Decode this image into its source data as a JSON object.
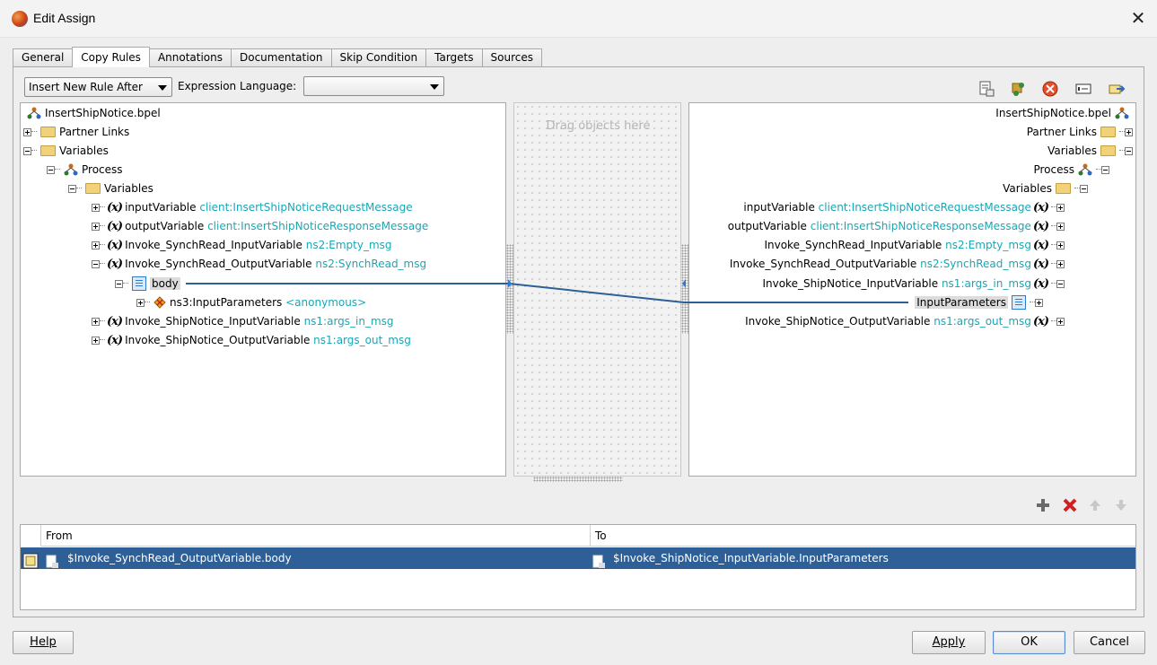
{
  "window": {
    "title": "Edit Assign",
    "close_glyph": "✕"
  },
  "tabs": [
    "General",
    "Copy Rules",
    "Annotations",
    "Documentation",
    "Skip Condition",
    "Targets",
    "Sources"
  ],
  "active_tab": "Copy Rules",
  "toolbar": {
    "insert_rule": "Insert New Rule After",
    "expression_language_label": "Expression Language:",
    "expression_language_value": "",
    "icons": [
      "xpath-function-icon",
      "xml-fragment-icon",
      "bpel-literal-icon",
      "expression-icon",
      "copy-list-icon"
    ]
  },
  "source_tree": {
    "root": "InsertShipNotice.bpel",
    "partner_links": "Partner Links",
    "variables": "Variables",
    "process": "Process",
    "process_variables": "Variables",
    "items": [
      {
        "name": "inputVariable",
        "type": "client:InsertShipNoticeRequestMessage"
      },
      {
        "name": "outputVariable",
        "type": "client:InsertShipNoticeResponseMessage"
      },
      {
        "name": "Invoke_SynchRead_InputVariable",
        "type": "ns2:Empty_msg"
      },
      {
        "name": "Invoke_SynchRead_OutputVariable",
        "type": "ns2:SynchRead_msg"
      },
      {
        "name": "Invoke_ShipNotice_InputVariable",
        "type": "ns1:args_in_msg"
      },
      {
        "name": "Invoke_ShipNotice_OutputVariable",
        "type": "ns1:args_out_msg"
      }
    ],
    "part": "body",
    "element": {
      "name": "ns3:InputParameters",
      "type": "<anonymous>"
    }
  },
  "drag_area": {
    "placeholder": "Drag objects here"
  },
  "target_tree": {
    "root": "InsertShipNotice.bpel",
    "partner_links": "Partner Links",
    "variables": "Variables",
    "process": "Process",
    "process_variables": "Variables",
    "items": [
      {
        "name": "inputVariable",
        "type": "client:InsertShipNoticeRequestMessage"
      },
      {
        "name": "outputVariable",
        "type": "client:InsertShipNoticeResponseMessage"
      },
      {
        "name": "Invoke_SynchRead_InputVariable",
        "type": "ns2:Empty_msg"
      },
      {
        "name": "Invoke_SynchRead_OutputVariable",
        "type": "ns2:SynchRead_msg"
      },
      {
        "name": "Invoke_ShipNotice_InputVariable",
        "type": "ns1:args_in_msg"
      },
      {
        "name": "Invoke_ShipNotice_OutputVariable",
        "type": "ns1:args_out_msg"
      }
    ],
    "part": "InputParameters"
  },
  "rules_table": {
    "headers": {
      "from": "From",
      "to": "To"
    },
    "rows": [
      {
        "from": "$Invoke_SynchRead_OutputVariable.body",
        "to": "$Invoke_ShipNotice_InputVariable.InputParameters"
      }
    ]
  },
  "buttons": {
    "help": "Help",
    "apply": "Apply",
    "ok": "OK",
    "cancel": "Cancel"
  },
  "colors": {
    "link_line": "#2e5f96",
    "selected_row": "#2e5f96",
    "type_text": "#1aa7b5"
  }
}
